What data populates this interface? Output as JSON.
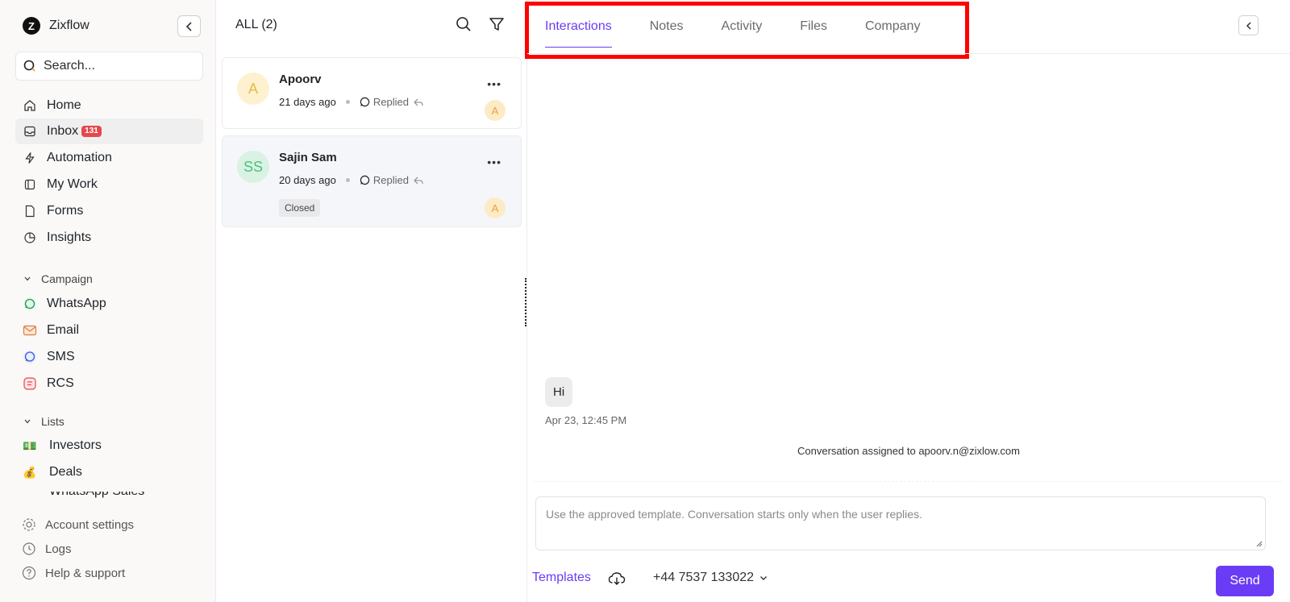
{
  "app": {
    "name": "Zixflow",
    "logo_letter": "Z"
  },
  "sidebar": {
    "search_placeholder": "Search...",
    "nav": [
      {
        "label": "Home",
        "icon": "home-icon"
      },
      {
        "label": "Inbox",
        "icon": "inbox-icon",
        "badge": "131",
        "active": true
      },
      {
        "label": "Automation",
        "icon": "lightning-icon"
      },
      {
        "label": "My Work",
        "icon": "sidebar-panel-icon"
      },
      {
        "label": "Forms",
        "icon": "document-icon"
      },
      {
        "label": "Insights",
        "icon": "pie-chart-icon"
      }
    ],
    "campaign": {
      "heading": "Campaign",
      "items": [
        {
          "label": "WhatsApp",
          "icon": "whatsapp-icon"
        },
        {
          "label": "Email",
          "icon": "email-icon"
        },
        {
          "label": "SMS",
          "icon": "sms-icon"
        },
        {
          "label": "RCS",
          "icon": "rcs-icon"
        }
      ]
    },
    "lists": {
      "heading": "Lists",
      "items": [
        {
          "label": "Investors",
          "emoji": "💵"
        },
        {
          "label": "Deals",
          "emoji": "💰"
        }
      ],
      "partial_item": "WhatsApp Sales"
    },
    "footer": [
      {
        "label": "Account settings",
        "icon": "gear-icon"
      },
      {
        "label": "Logs",
        "icon": "clock-icon"
      },
      {
        "label": "Help & support",
        "icon": "help-icon"
      }
    ]
  },
  "conversations": {
    "title": "ALL (2)",
    "items": [
      {
        "name": "Apoorv",
        "initials": "A",
        "time": "21 days ago",
        "status": "Replied",
        "assignee": "A",
        "tag": ""
      },
      {
        "name": "Sajin Sam",
        "initials": "SS",
        "time": "20 days ago",
        "status": "Replied",
        "assignee": "A",
        "tag": "Closed",
        "selected": true
      }
    ],
    "more_glyph": "•••"
  },
  "main": {
    "tabs": [
      "Interactions",
      "Notes",
      "Activity",
      "Files",
      "Company"
    ],
    "active_tab": "Interactions",
    "messages": [
      {
        "text": "Hi",
        "time": "Apr 23, 12:45 PM"
      }
    ],
    "system_message": "Conversation assigned to apoorv.n@zixlow.com",
    "composer_placeholder": "Use the approved template. Conversation starts only when the user replies.",
    "templates_label": "Templates",
    "phone_number": "+44 7537 133022",
    "send_label": "Send"
  },
  "colors": {
    "accent": "#6b3cf6",
    "badge": "#e5484d",
    "highlight": "#ff0000",
    "avatar_apoorv_bg": "#fdf1cf",
    "avatar_sajin_bg": "#d9f2e3"
  }
}
